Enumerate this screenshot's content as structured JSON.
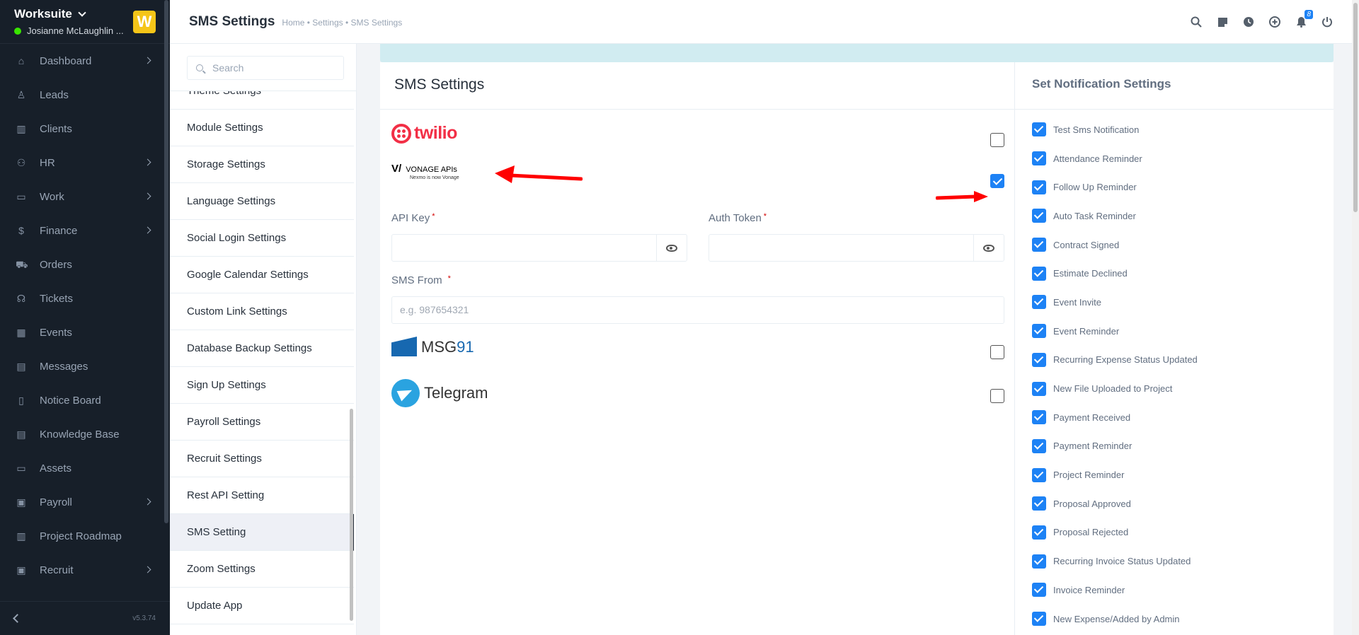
{
  "sidebar": {
    "company": "Worksuite",
    "user": "Josianne McLaughlin ...",
    "logo_letter": "W",
    "version": "v5.3.74",
    "items": [
      {
        "label": "Dashboard",
        "icon": "home-icon",
        "glyph": "⌂",
        "arrow": true
      },
      {
        "label": "Leads",
        "icon": "user-icon",
        "glyph": "♙",
        "arrow": false
      },
      {
        "label": "Clients",
        "icon": "building-icon",
        "glyph": "▥",
        "arrow": false
      },
      {
        "label": "HR",
        "icon": "people-icon",
        "glyph": "⚇",
        "arrow": true
      },
      {
        "label": "Work",
        "icon": "briefcase-icon",
        "glyph": "▭",
        "arrow": true
      },
      {
        "label": "Finance",
        "icon": "dollar-icon",
        "glyph": "$",
        "arrow": true
      },
      {
        "label": "Orders",
        "icon": "cart-icon",
        "glyph": "⛟",
        "arrow": false
      },
      {
        "label": "Tickets",
        "icon": "headset-icon",
        "glyph": "☊",
        "arrow": false
      },
      {
        "label": "Events",
        "icon": "calendar-icon",
        "glyph": "▦",
        "arrow": false
      },
      {
        "label": "Messages",
        "icon": "chat-icon",
        "glyph": "▤",
        "arrow": false
      },
      {
        "label": "Notice Board",
        "icon": "clipboard-icon",
        "glyph": "▯",
        "arrow": false
      },
      {
        "label": "Knowledge Base",
        "icon": "book-icon",
        "glyph": "▤",
        "arrow": false
      },
      {
        "label": "Assets",
        "icon": "monitor-icon",
        "glyph": "▭",
        "arrow": false
      },
      {
        "label": "Payroll",
        "icon": "wallet-icon",
        "glyph": "▣",
        "arrow": true
      },
      {
        "label": "Project Roadmap",
        "icon": "roadmap-icon",
        "glyph": "▥",
        "arrow": false
      },
      {
        "label": "Recruit",
        "icon": "id-badge-icon",
        "glyph": "▣",
        "arrow": true
      }
    ]
  },
  "topbar": {
    "title": "SMS Settings",
    "breadcrumb": "Home • Settings • SMS Settings",
    "notification_count": "8"
  },
  "submenu": {
    "search_placeholder": "Search",
    "items": [
      "Theme Settings",
      "Module Settings",
      "Storage Settings",
      "Language Settings",
      "Social Login Settings",
      "Google Calendar Settings",
      "Custom Link Settings",
      "Database Backup Settings",
      "Sign Up Settings",
      "Payroll Settings",
      "Recruit Settings",
      "Rest API Setting",
      "SMS Setting",
      "Zoom Settings",
      "Update App"
    ],
    "active_index": 12
  },
  "sms": {
    "title": "SMS Settings",
    "twilio_logo": "twilio",
    "vonage_logo": "VONAGE APIs",
    "vonage_sub": "Nexmo is now Vonage",
    "msg91_text_a": "MSG",
    "msg91_text_b": "91",
    "telegram_logo": "Telegram",
    "api_key_label": "API Key",
    "auth_token_label": "Auth Token",
    "sms_from_label": "SMS From",
    "sms_from_placeholder": "e.g. 987654321",
    "required_mark": "*",
    "gateways": {
      "twilio": false,
      "vonage": true,
      "msg91": false,
      "telegram": false
    }
  },
  "notifications": {
    "title": "Set Notification Settings",
    "items": [
      "Test Sms Notification",
      "Attendance Reminder",
      "Follow Up Reminder",
      "Auto Task Reminder",
      "Contract Signed",
      "Estimate Declined",
      "Event Invite",
      "Event Reminder",
      "Recurring Expense Status Updated",
      "New File Uploaded to Project",
      "Payment Received",
      "Payment Reminder",
      "Project Reminder",
      "Proposal Approved",
      "Proposal Rejected",
      "Recurring Invoice Status Updated",
      "Invoice Reminder",
      "New Expense/Added by Admin"
    ]
  },
  "colors": {
    "accent": "#1d82f5",
    "sidebar_bg": "#171f29",
    "twilio": "#f22f46",
    "arrow": "#ff0000"
  }
}
